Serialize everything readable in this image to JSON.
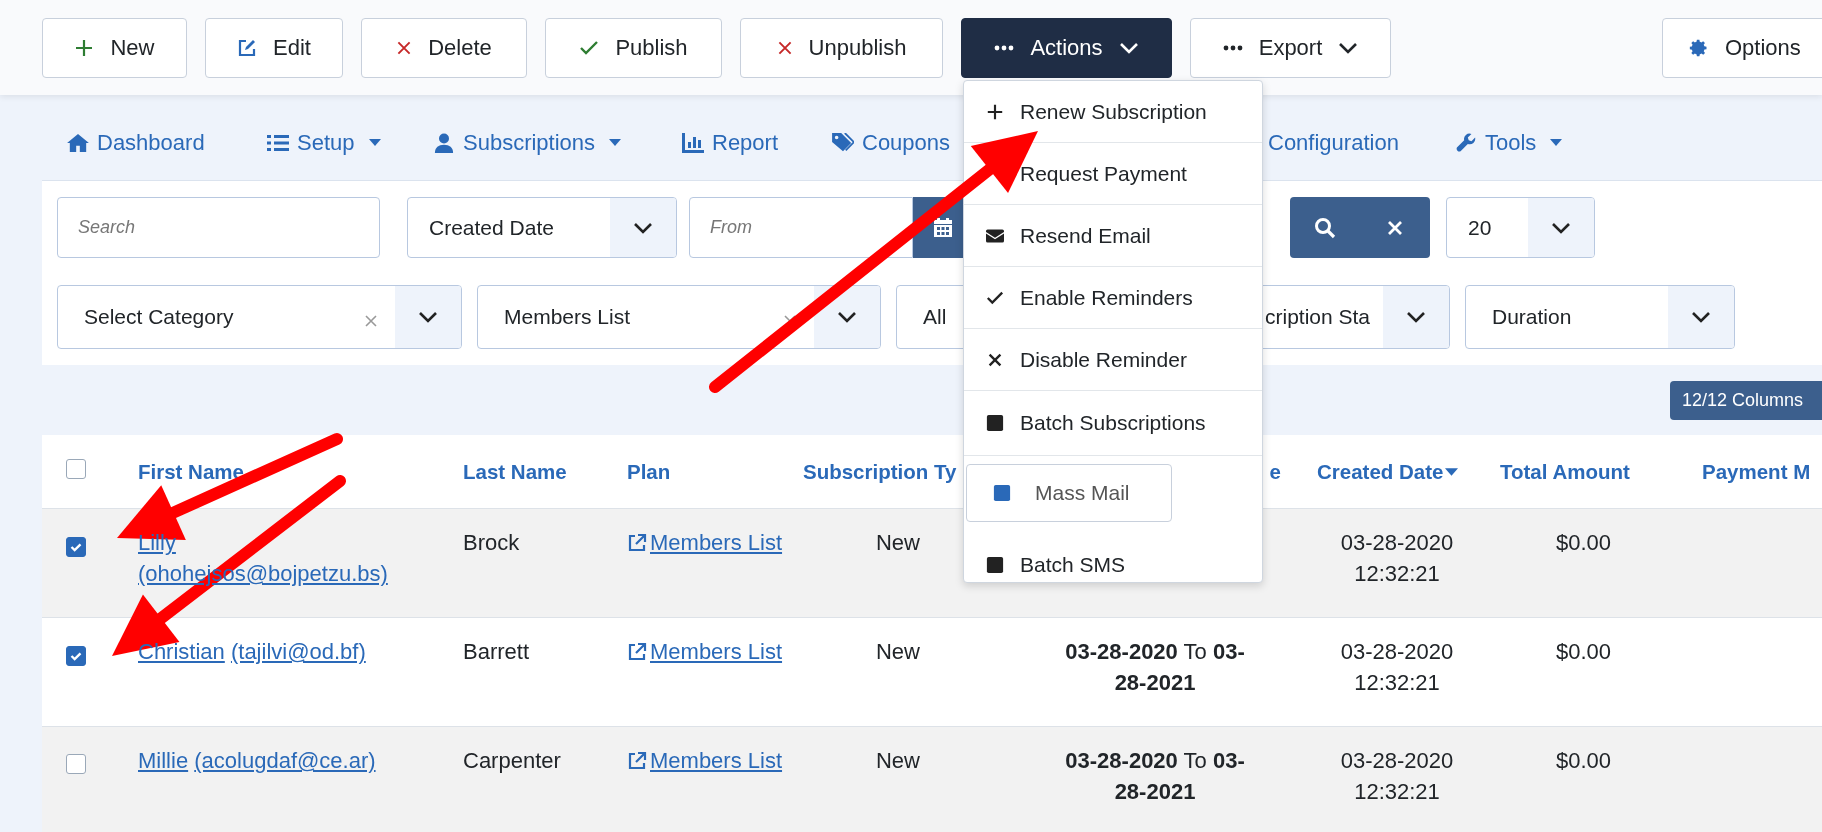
{
  "toolbar": {
    "buttons": [
      {
        "label": "New",
        "kind": "new"
      },
      {
        "label": "Edit",
        "kind": "edit"
      },
      {
        "label": "Delete",
        "kind": "delete"
      },
      {
        "label": "Publish",
        "kind": "publish"
      },
      {
        "label": "Unpublish",
        "kind": "unpublish"
      },
      {
        "label": "Actions",
        "kind": "dropdown",
        "expanded": true
      },
      {
        "label": "Export",
        "kind": "dropdown",
        "expanded": false
      },
      {
        "label": "Options",
        "kind": "options"
      }
    ]
  },
  "actions_menu": {
    "items": [
      {
        "label": "Renew Subscription",
        "kind": "plus"
      },
      {
        "label": "Request Payment",
        "kind": "plain"
      },
      {
        "label": "Resend Email",
        "kind": "envelope"
      },
      {
        "label": "Enable Reminders",
        "kind": "check"
      },
      {
        "label": "Disable Reminder",
        "kind": "times"
      },
      {
        "label": "Batch Subscriptions",
        "kind": "square"
      },
      {
        "label": "Mass Mail",
        "kind": "framed"
      },
      {
        "label": "Batch SMS",
        "kind": "square"
      }
    ]
  },
  "nav": {
    "items": [
      {
        "label": "Dashboard",
        "kind": "home",
        "dropdown": false
      },
      {
        "label": "Setup",
        "kind": "list",
        "dropdown": true
      },
      {
        "label": "Subscriptions",
        "kind": "user",
        "dropdown": true
      },
      {
        "label": "Report",
        "kind": "chart",
        "dropdown": false
      },
      {
        "label": "Coupons",
        "kind": "tag",
        "dropdown": false
      },
      {
        "label": "Configuration",
        "kind": "plain",
        "dropdown": false
      },
      {
        "label": "Tools",
        "kind": "wrench",
        "dropdown": true
      }
    ]
  },
  "filters": {
    "search": {
      "placeholder": "Search"
    },
    "date_type": {
      "value": "Created Date"
    },
    "date_from": {
      "placeholder": "From"
    },
    "limit": {
      "value": "20"
    },
    "selects": [
      {
        "value": "Select Category",
        "clearable": true
      },
      {
        "value": "Members List",
        "clearable": true
      },
      {
        "value": "All"
      },
      {
        "value": "cription Sta",
        "clearable": false
      },
      {
        "value": "Duration",
        "clearable": false
      }
    ]
  },
  "columns_button": {
    "label": "12/12 Columns"
  },
  "table": {
    "select_all": {
      "checked": false
    },
    "columns": [
      {
        "label": "First Name",
        "sorted": false
      },
      {
        "label": "Last Name",
        "sorted": false
      },
      {
        "label": "Plan",
        "sorted": false
      },
      {
        "label": "Subscription Ty",
        "sorted": false
      },
      {
        "label": "e",
        "sorted": false
      },
      {
        "label": "Created Date",
        "sorted": true
      },
      {
        "label": "Total Amount",
        "sorted": false
      },
      {
        "label": "Payment M"
      }
    ],
    "rows": [
      {
        "selected": true,
        "first_name": "Lilly",
        "email": "(ohohejsos@bojpetzu.bs)",
        "last_name": "Brock",
        "plan": "Members List",
        "type": "New",
        "created": "03-28-2020 12:32:21",
        "amount": "$0.00"
      },
      {
        "selected": true,
        "first_name": "Christian",
        "email": "(tajilvi@od.bf)",
        "last_name": "Barrett",
        "plan": "Members List",
        "type": "New",
        "period": "**03-28-2020** To **03-28-2021**",
        "created": "03-28-2020 12:32:21",
        "amount": "$0.00"
      },
      {
        "selected": false,
        "first_name": "Millie",
        "email": "(acolugdaf@ce.ar)",
        "last_name": "Carpenter",
        "plan": "Members List",
        "type": "New",
        "period": "**03-28-2020** To **03-28-2021**",
        "created": "03-28-2020 12:32:21",
        "amount": "$0.00"
      }
    ]
  }
}
